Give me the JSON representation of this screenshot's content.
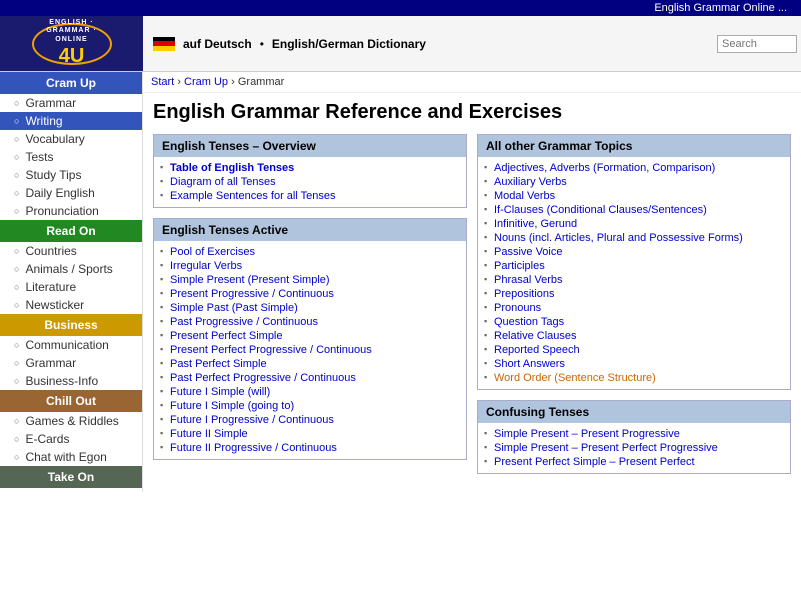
{
  "topbar": {
    "title": "English Grammar Online ..."
  },
  "header": {
    "logo_text": "ENGLISH · GRAMMAR · ONLINE",
    "logo_4u": "4U",
    "lang_text": "auf Deutsch",
    "dict_text": "English/German Dictionary",
    "search_placeholder": "Search"
  },
  "breadcrumb": {
    "start": "Start",
    "separator1": " › ",
    "cram_up": "Cram Up",
    "separator2": " › ",
    "current": "Grammar"
  },
  "page_title": "English Grammar Reference and Exercises",
  "sidebar": {
    "sections": [
      {
        "id": "cram-up",
        "label": "Cram Up",
        "color": "#3355bb",
        "items": [
          {
            "id": "grammar",
            "label": "Grammar",
            "active": false
          },
          {
            "id": "writing",
            "label": "Writing",
            "active": true
          },
          {
            "id": "vocabulary",
            "label": "Vocabulary",
            "active": false
          },
          {
            "id": "tests",
            "label": "Tests",
            "active": false
          },
          {
            "id": "study-tips",
            "label": "Study Tips",
            "active": false
          },
          {
            "id": "daily-english",
            "label": "Daily English",
            "active": false
          },
          {
            "id": "pronunciation",
            "label": "Pronunciation",
            "active": false
          }
        ]
      },
      {
        "id": "read-on",
        "label": "Read On",
        "color": "#228822",
        "items": [
          {
            "id": "countries",
            "label": "Countries",
            "active": false
          },
          {
            "id": "animals-sports",
            "label": "Animals / Sports",
            "active": false
          },
          {
            "id": "literature",
            "label": "Literature",
            "active": false
          },
          {
            "id": "newsticker",
            "label": "Newsticker",
            "active": false
          }
        ]
      },
      {
        "id": "business",
        "label": "Business",
        "color": "#996600",
        "items": [
          {
            "id": "communication",
            "label": "Communication",
            "active": false
          },
          {
            "id": "grammar-b",
            "label": "Grammar",
            "active": false
          },
          {
            "id": "business-info",
            "label": "Business-Info",
            "active": false
          }
        ]
      },
      {
        "id": "chill-out",
        "label": "Chill Out",
        "color": "#885500",
        "items": [
          {
            "id": "games-riddles",
            "label": "Games & Riddles",
            "active": false
          },
          {
            "id": "e-cards",
            "label": "E-Cards",
            "active": false
          },
          {
            "id": "chat-egon",
            "label": "Chat with Egon",
            "active": false
          }
        ]
      },
      {
        "id": "take-on",
        "label": "Take On",
        "color": "#556655",
        "items": []
      }
    ]
  },
  "tenses_box": {
    "header": "English Tenses – Overview",
    "links": [
      {
        "label": "Table of English Tenses",
        "highlight": true
      },
      {
        "label": "Diagram of all Tenses"
      },
      {
        "label": "Example Sentences for all Tenses"
      }
    ]
  },
  "tenses_active_box": {
    "header": "English Tenses Active",
    "links": [
      {
        "label": "Pool of Exercises"
      },
      {
        "label": "Irregular Verbs"
      },
      {
        "label": "Simple Present (Present Simple)"
      },
      {
        "label": "Present Progressive / Continuous"
      },
      {
        "label": "Simple Past (Past Simple)"
      },
      {
        "label": "Past Progressive / Continuous"
      },
      {
        "label": "Present Perfect Simple"
      },
      {
        "label": "Present Perfect Progressive / Continuous"
      },
      {
        "label": "Past Perfect Simple"
      },
      {
        "label": "Past Perfect Progressive / Continuous"
      },
      {
        "label": "Future I Simple (will)"
      },
      {
        "label": "Future I Simple (going to)"
      },
      {
        "label": "Future I Progressive / Continuous"
      },
      {
        "label": "Future II Simple"
      },
      {
        "label": "Future II Progressive / Continuous"
      }
    ]
  },
  "other_topics_box": {
    "header": "All other Grammar Topics",
    "links": [
      {
        "label": "Adjectives, Adverbs (Formation, Comparison)"
      },
      {
        "label": "Auxiliary Verbs"
      },
      {
        "label": "Modal Verbs"
      },
      {
        "label": "If-Clauses (Conditional Clauses/Sentences)"
      },
      {
        "label": "Infinitive, Gerund"
      },
      {
        "label": "Nouns (incl. Articles, Plural and Possessive Forms)"
      },
      {
        "label": "Passive Voice"
      },
      {
        "label": "Participles"
      },
      {
        "label": "Phrasal Verbs"
      },
      {
        "label": "Prepositions"
      },
      {
        "label": "Pronouns"
      },
      {
        "label": "Question Tags"
      },
      {
        "label": "Relative Clauses"
      },
      {
        "label": "Reported Speech"
      },
      {
        "label": "Short Answers"
      },
      {
        "label": "Word Order (Sentence Structure)",
        "special": true
      }
    ]
  },
  "confusing_tenses_box": {
    "header": "Confusing Tenses",
    "links": [
      {
        "label": "Simple Present – Present Progressive"
      },
      {
        "label": "Simple Present – Present Perfect Progressive"
      },
      {
        "label": "Present Perfect Simple – Present Perfect"
      }
    ]
  }
}
